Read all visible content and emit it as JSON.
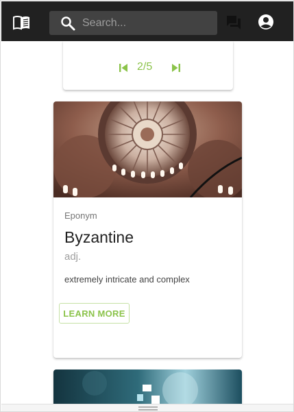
{
  "appbar": {
    "search_placeholder": "Search...",
    "icons": [
      "book-icon",
      "search-icon",
      "forum-icon",
      "account-circle-icon"
    ]
  },
  "pager": {
    "label": "2/5",
    "accent": "#8bc34a"
  },
  "card": {
    "kicker": "Eponym",
    "word": "Byzantine",
    "part_of_speech": "adj.",
    "definition": "extremely intricate and complex",
    "button_label": "LEARN MORE"
  }
}
